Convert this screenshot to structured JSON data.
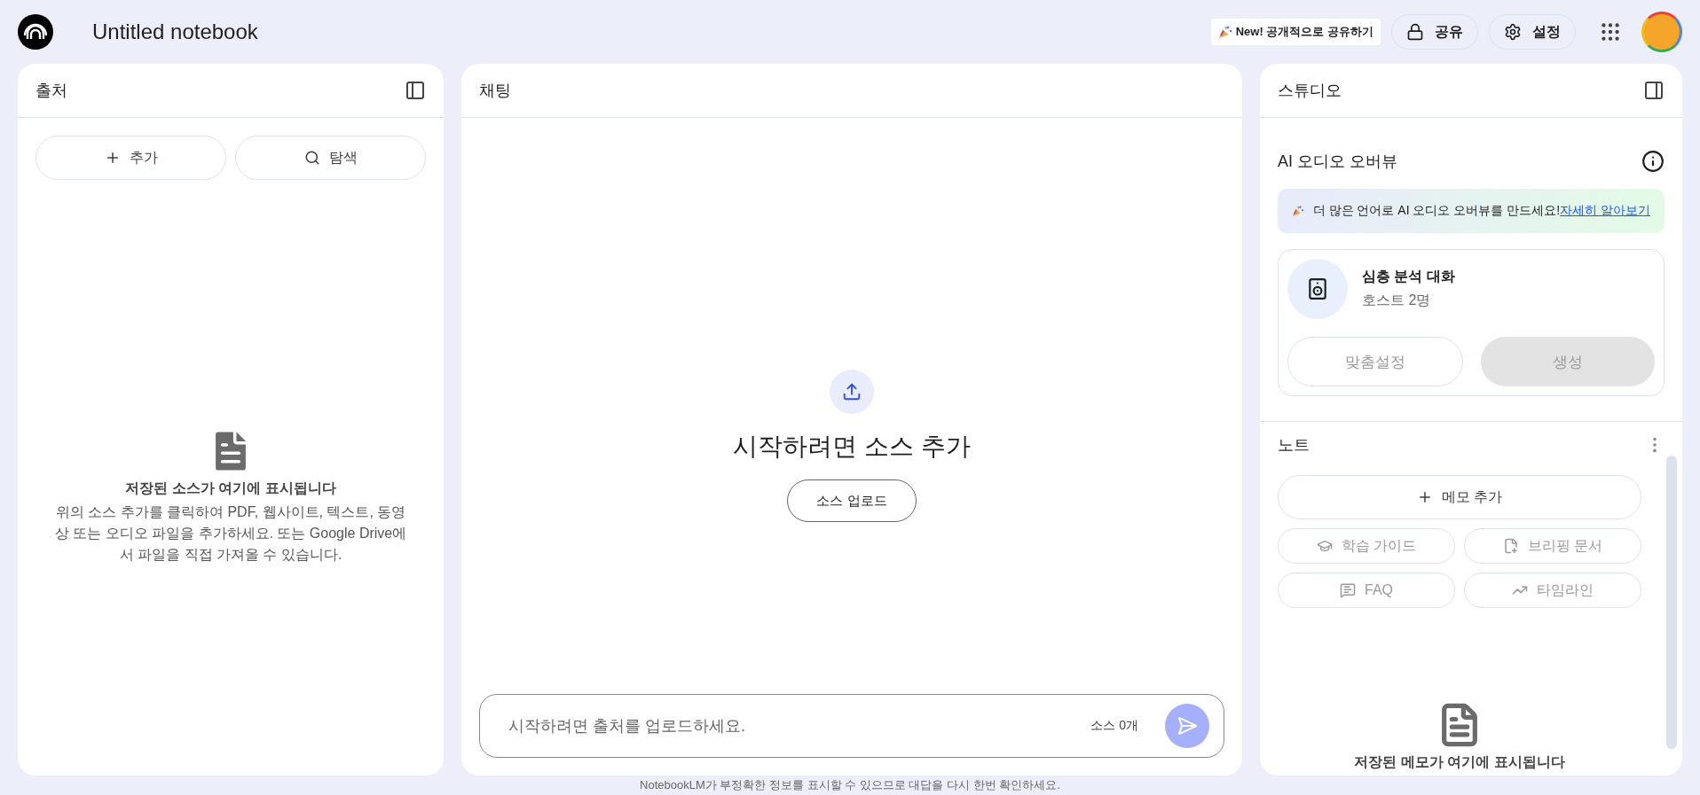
{
  "header": {
    "title": "Untitled notebook",
    "promo": "New! 공개적으로 공유하기",
    "buttons": [
      {
        "label": "공유",
        "kind": "lock"
      },
      {
        "label": "설정",
        "kind": "gear"
      }
    ]
  },
  "sources": {
    "title": "출처",
    "actions": [
      {
        "label": "추가",
        "kind": "plus"
      },
      {
        "label": "탐색",
        "kind": "search"
      }
    ],
    "empty": {
      "title": "저장된 소스가 여기에 표시됩니다",
      "body": "위의 소스 추가를 클릭하여 PDF, 웹사이트, 텍스트, 동영상 또는 오디오 파일을 추가하세요. 또는 Google Drive에서 파일을 직접 가져올 수 있습니다."
    }
  },
  "chat": {
    "title": "채팅",
    "empty": {
      "heading": "시작하려면 소스 추가",
      "button": "소스 업로드"
    },
    "input": {
      "placeholder": "시작하려면 출처를 업로드하세요.",
      "count": "소스 0개",
      "send_disabled": true
    }
  },
  "studio": {
    "title": "스튜디오",
    "audio": {
      "title": "AI 오디오 오버뷰",
      "banner": {
        "text": "더 많은 언어로 AI 오디오 오버뷰를 만드세요!",
        "link": "자세히 알아보기"
      },
      "card": {
        "title": "심층 분석 대화",
        "subtitle": "호스트 2명"
      },
      "buttons": [
        {
          "label": "맞춤설정",
          "kind": "outline",
          "disabled": true
        },
        {
          "label": "생성",
          "kind": "filled",
          "disabled": true
        }
      ]
    },
    "notes": {
      "title": "노트",
      "add": {
        "label": "메모 추가",
        "disabled": false
      },
      "tools": [
        {
          "label": "학습 가이드",
          "kind": "cap",
          "disabled": true
        },
        {
          "label": "브리핑 문서",
          "kind": "doc",
          "disabled": true
        },
        {
          "label": "FAQ",
          "kind": "faq",
          "disabled": true
        },
        {
          "label": "타임라인",
          "kind": "trend",
          "disabled": true
        }
      ],
      "empty": "저장된 메모가 여기에 표시됩니다"
    }
  },
  "disclaimer": "NotebookLM가 부정확한 정보를 표시할 수 있으므로 대답을 다시 한번 확인하세요."
}
